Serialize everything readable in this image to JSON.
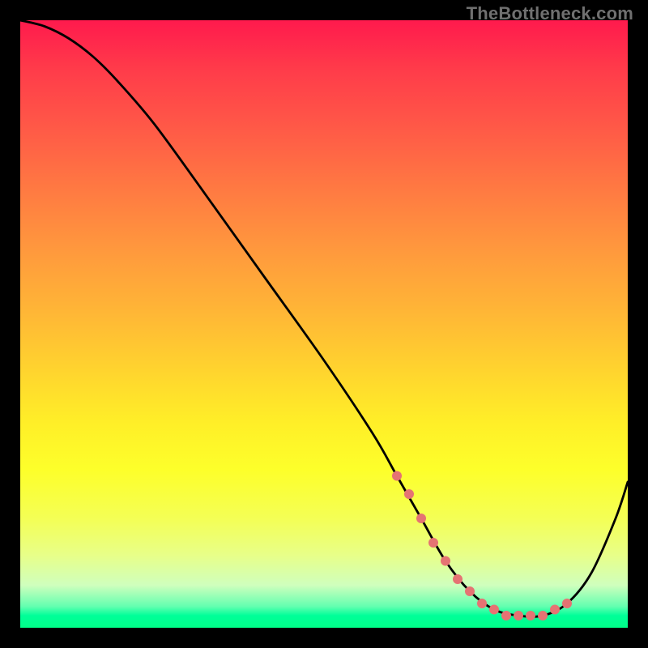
{
  "watermark": "TheBottleneck.com",
  "chart_data": {
    "type": "line",
    "title": "",
    "xlabel": "",
    "ylabel": "",
    "xlim": [
      0,
      100
    ],
    "ylim": [
      0,
      100
    ],
    "grid": false,
    "series": [
      {
        "name": "bottleneck-curve",
        "x": [
          0,
          4,
          8,
          12,
          16,
          22,
          30,
          40,
          50,
          58,
          62,
          66,
          70,
          74,
          78,
          82,
          86,
          90,
          94,
          98,
          100
        ],
        "values": [
          100,
          99,
          97,
          94,
          90,
          83,
          72,
          58,
          44,
          32,
          25,
          18,
          11,
          6,
          3,
          2,
          2,
          4,
          9,
          18,
          24
        ]
      }
    ],
    "markers": {
      "name": "dotted-segment",
      "color": "#e57373",
      "x": [
        62,
        64,
        66,
        68,
        70,
        72,
        74,
        76,
        78,
        80,
        82,
        84,
        86,
        88,
        90
      ],
      "values": [
        25,
        22,
        18,
        14,
        11,
        8,
        6,
        4,
        3,
        2,
        2,
        2,
        2,
        3,
        4
      ]
    },
    "background_gradient": {
      "top": "#ff1a4d",
      "mid": "#ffd52e",
      "bottom": "#00ff88"
    }
  }
}
